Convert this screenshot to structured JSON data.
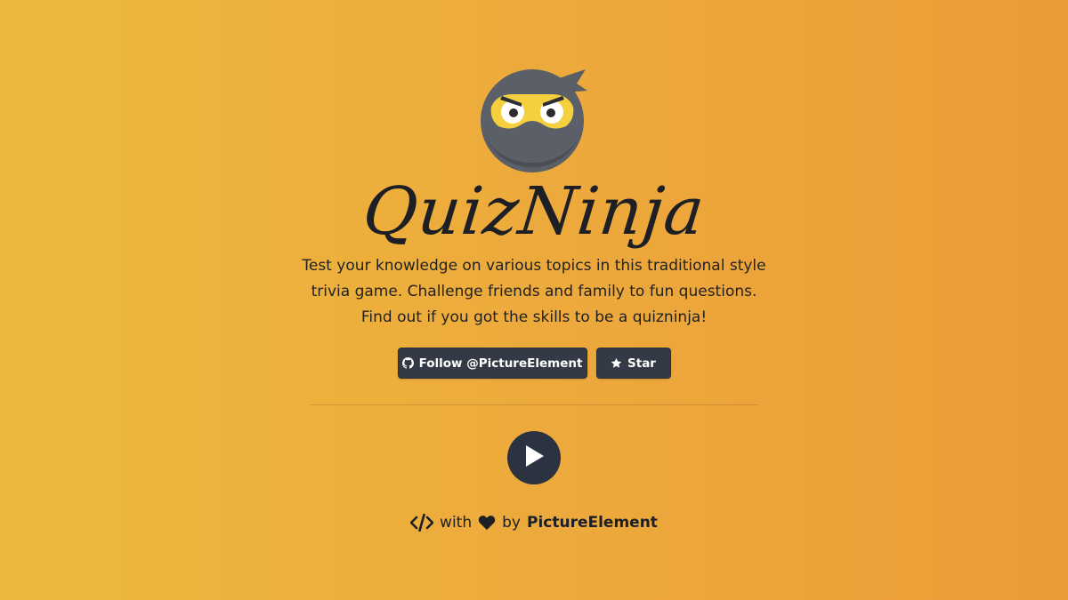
{
  "app": {
    "title": "QuizNinja",
    "description_lines": [
      "Test your knowledge on various topics in this traditional style",
      "trivia game. Challenge friends and family to fun questions.",
      "Find out if you got the skills to be a quizninja!"
    ]
  },
  "buttons": {
    "follow_label": "Follow @PictureElement",
    "follow_icon": "github-icon",
    "star_label": "Star",
    "star_icon": "star-icon",
    "play_icon": "play-icon"
  },
  "footer": {
    "code_icon": "code-icon",
    "with_text": "with",
    "heart_icon": "heart-icon",
    "by_text": "by",
    "author": "PictureElement"
  },
  "colors": {
    "background_start": "#EDB93D",
    "background_end": "#EA9C37",
    "button_bg": "#333A45",
    "play_bg": "#2C3340",
    "text": "#1D1F24",
    "logo_mask": "#F4D03F"
  }
}
